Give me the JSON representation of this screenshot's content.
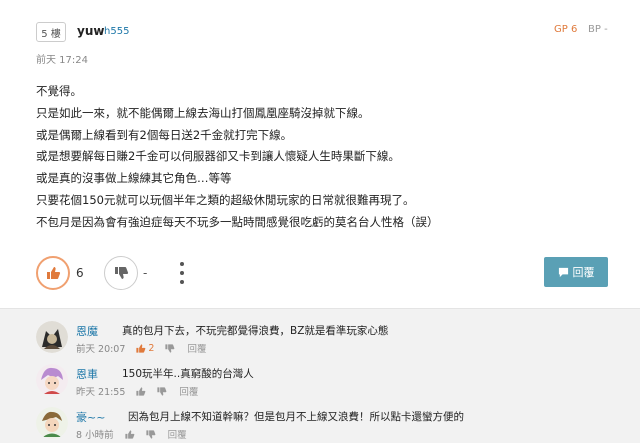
{
  "post": {
    "floor": "5 樓",
    "author": "yuw",
    "author_id": "h555",
    "time": "前天 17:24",
    "gp": "GP 6",
    "bp": "BP -",
    "content": [
      "不覺得。",
      "只是如此一來，就不能偶爾上線去海山打個鳳凰座騎沒掉就下線。",
      "或是偶爾上線看到有2個每日送2千金就打完下線。",
      "或是想要解每日賺2千金可以伺服器卻又卡到讓人懷疑人生時果斷下線。",
      "或是真的沒事做上線練其它角色…等等",
      "只要花個150元就可以玩個半年之類的超級休閒玩家的日常就很難再現了。",
      "不包月是因為會有強迫症每天不玩多一點時間感覺很吃虧的莫名台人性格（誤）"
    ],
    "gp_count": "6",
    "bp_count": "-",
    "reply_label": "回覆"
  },
  "comments": [
    {
      "name": "恩魔",
      "text": "真的包月下去，不玩完都覺得浪費，BZ就是看準玩家心態",
      "time": "前天 20:07",
      "gp": "2",
      "reply": "回覆"
    },
    {
      "name": "恩車",
      "text": "150玩半年..真窮酸的台灣人",
      "time": "昨天 21:55",
      "gp": "",
      "reply": "回覆"
    },
    {
      "name": "豪~~",
      "text": "因為包月上線不知道幹嘛？但是包月不上線又浪費！所以點卡還蠻方便的",
      "time": "8 小時前",
      "gp": "",
      "reply": "回覆"
    }
  ],
  "colors": {
    "accent_gp": "#e07a3c",
    "link": "#1d77a8",
    "reply_button": "#5aa0b5"
  }
}
